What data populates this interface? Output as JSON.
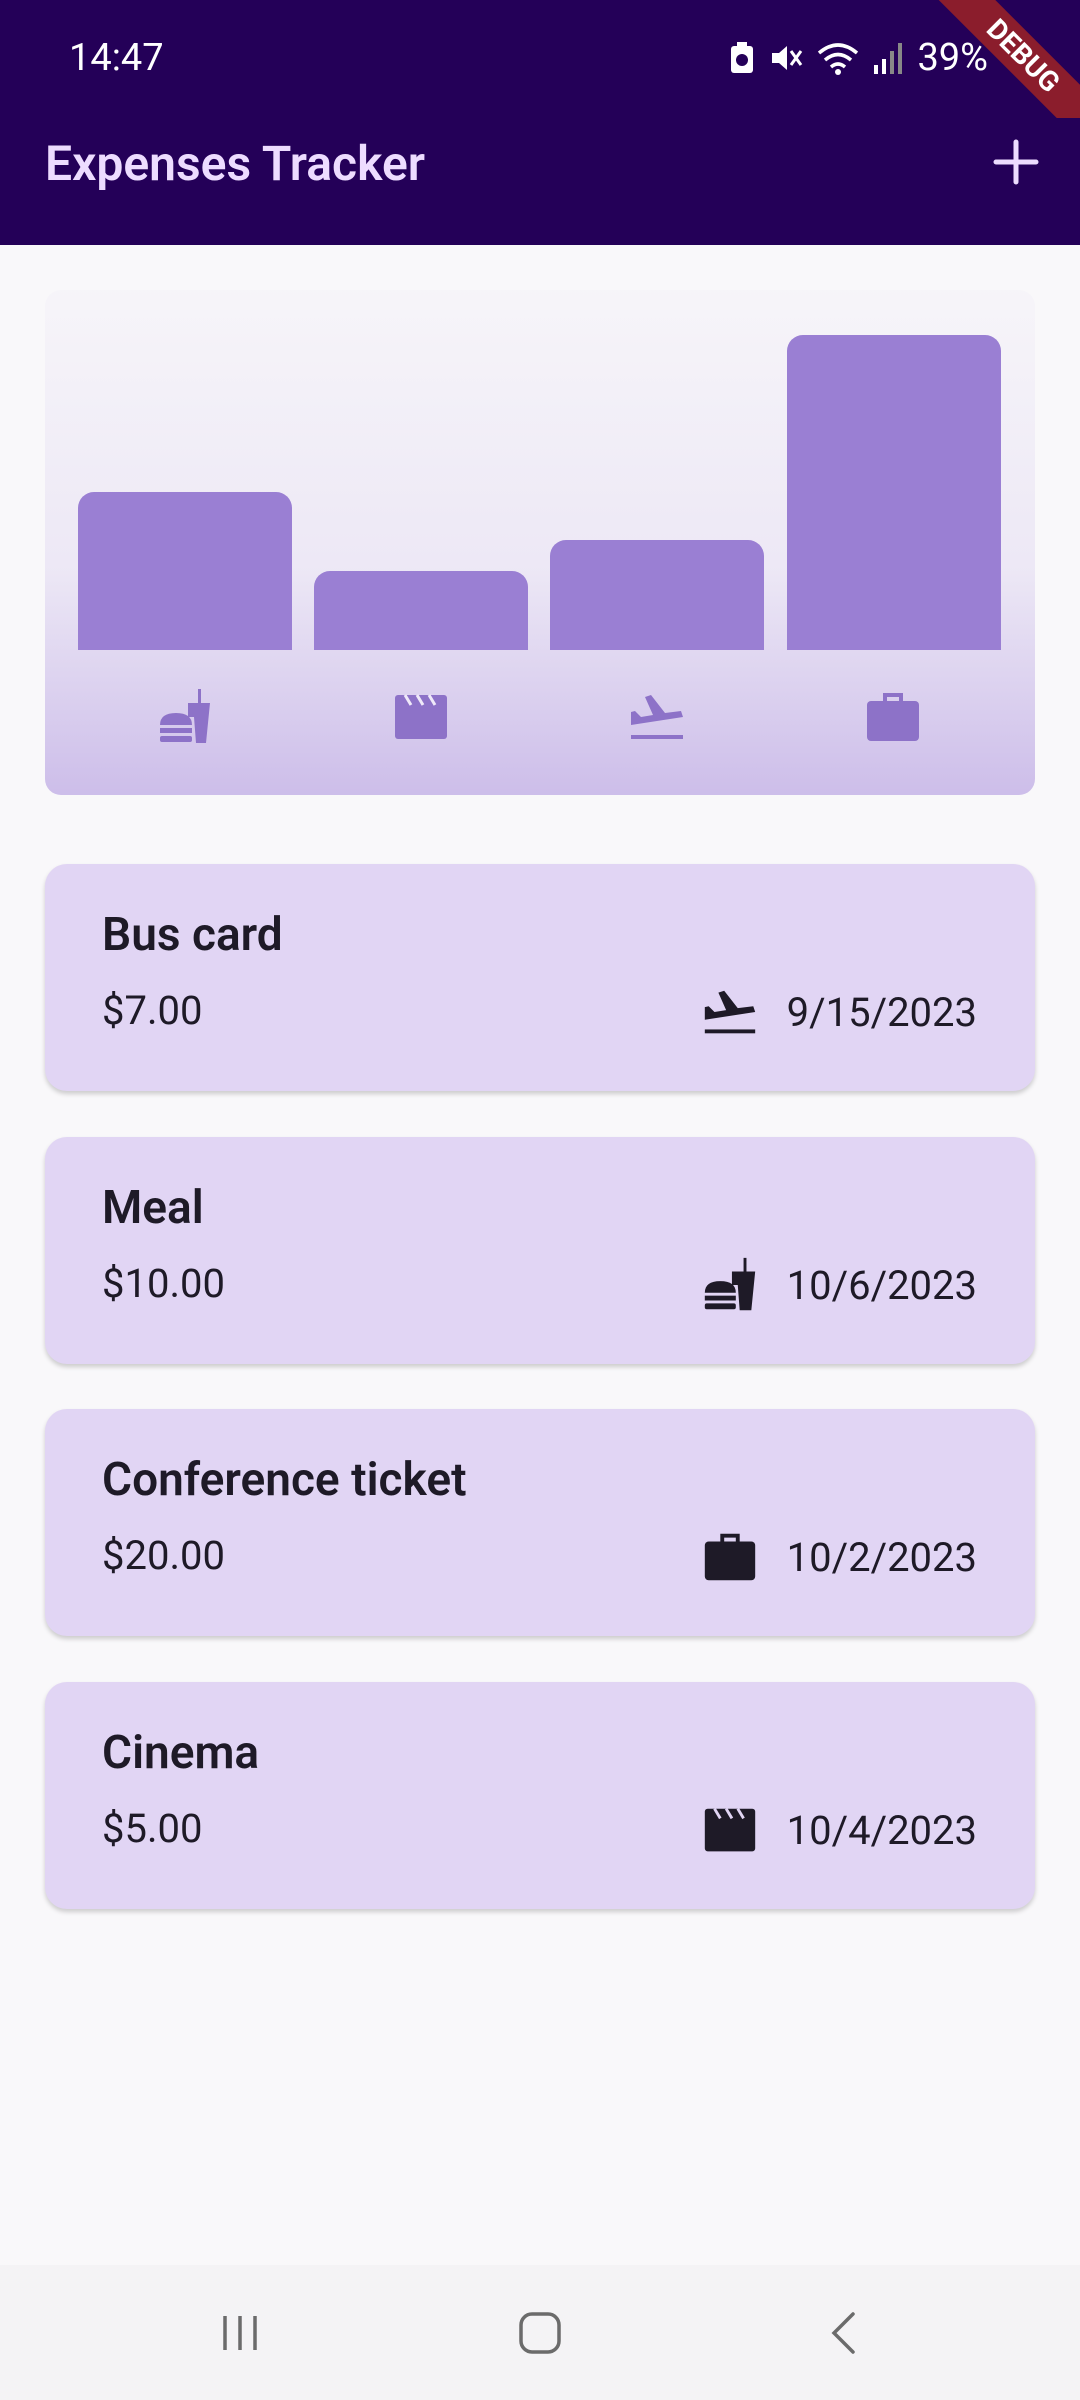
{
  "status_bar": {
    "time": "14:47",
    "battery": "39%",
    "icons": [
      "battery-saver-icon",
      "mute-icon",
      "wifi-icon",
      "signal-icon"
    ]
  },
  "app_bar": {
    "title": "Expenses Tracker",
    "add_icon": "plus-icon",
    "debug_label": "DEBUG"
  },
  "chart": {
    "bars": [
      {
        "category": "food",
        "icon": "food-icon",
        "fraction": 0.5
      },
      {
        "category": "leisure",
        "icon": "movie-icon",
        "fraction": 0.25
      },
      {
        "category": "travel",
        "icon": "flight-icon",
        "fraction": 0.35
      },
      {
        "category": "work",
        "icon": "work-icon",
        "fraction": 1.0
      }
    ]
  },
  "expenses": [
    {
      "title": "Bus card",
      "amount": "$7.00",
      "category_icon": "flight-icon",
      "date": "9/15/2023"
    },
    {
      "title": "Meal",
      "amount": "$10.00",
      "category_icon": "food-icon",
      "date": "10/6/2023"
    },
    {
      "title": "Conference ticket",
      "amount": "$20.00",
      "category_icon": "work-icon",
      "date": "10/2/2023"
    },
    {
      "title": "Cinema",
      "amount": "$5.00",
      "category_icon": "movie-icon",
      "date": "10/4/2023"
    }
  ],
  "colors": {
    "app_bar_bg": "#240058",
    "title_color": "#eddcff",
    "bar_color": "#9a7fd3",
    "card_bg": "#e1d5f4",
    "text_dark": "#1e1a27"
  },
  "nav_bar": {
    "icons": [
      "recent-apps-icon",
      "home-icon",
      "back-icon"
    ]
  }
}
